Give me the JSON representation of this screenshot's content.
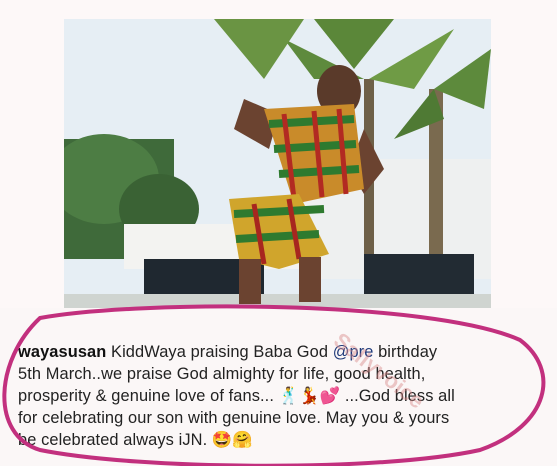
{
  "post": {
    "username": "wayasusan",
    "text_before_mention": "KiddWaya praising Baba God",
    "mention": "@pre",
    "text_line1_end": "birthday",
    "text_line2": "5th March..we praise God almighty for life, good health,",
    "text_line3": "prosperity & genuine love of fans...",
    "emojis_line3": "🕺💃💕",
    "text_line3_end": "...God bless all",
    "text_line4": "for celebrating our son with genuine love. May you & yours",
    "text_line5": "be celebrated always iJN.",
    "emojis_line5": "🤩🤗"
  },
  "watermark": "Sallyvoice"
}
